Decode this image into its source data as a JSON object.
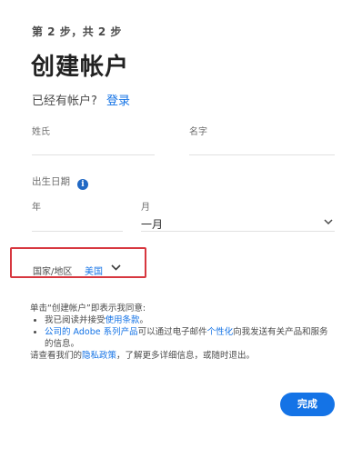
{
  "step_indicator": "第 2 步，共 2 步",
  "title": "创建帐户",
  "have_account": {
    "text": "已经有帐户?",
    "signin_link": "登录"
  },
  "fields": {
    "last_name_label": "姓氏",
    "first_name_label": "名字",
    "dob_label": "出生日期",
    "year_label": "年",
    "month_label": "月",
    "month_value": "一月"
  },
  "country": {
    "label": "国家/地区",
    "value": "美国"
  },
  "consent": {
    "intro": "单击“创建帐户”即表示我同意:",
    "bullet1_prefix": "我已阅读并接受",
    "bullet1_link": "使用条款",
    "bullet1_suffix": "。",
    "bullet2_link1": "公司的 Adobe 系列产品",
    "bullet2_mid": "可以通过电子邮件",
    "bullet2_link2": "个性化",
    "bullet2_suffix": "向我发送有关产品和服务的信息。",
    "footer_prefix": "请查看我们的",
    "footer_link": "隐私政策",
    "footer_suffix": "，了解更多详细信息，或随时退出。"
  },
  "done_button": "完成",
  "colors": {
    "accent": "#1473e6",
    "highlight_border": "#d7373f"
  },
  "icons": {
    "info": "info-icon",
    "chevron": "chevron-down-icon"
  }
}
